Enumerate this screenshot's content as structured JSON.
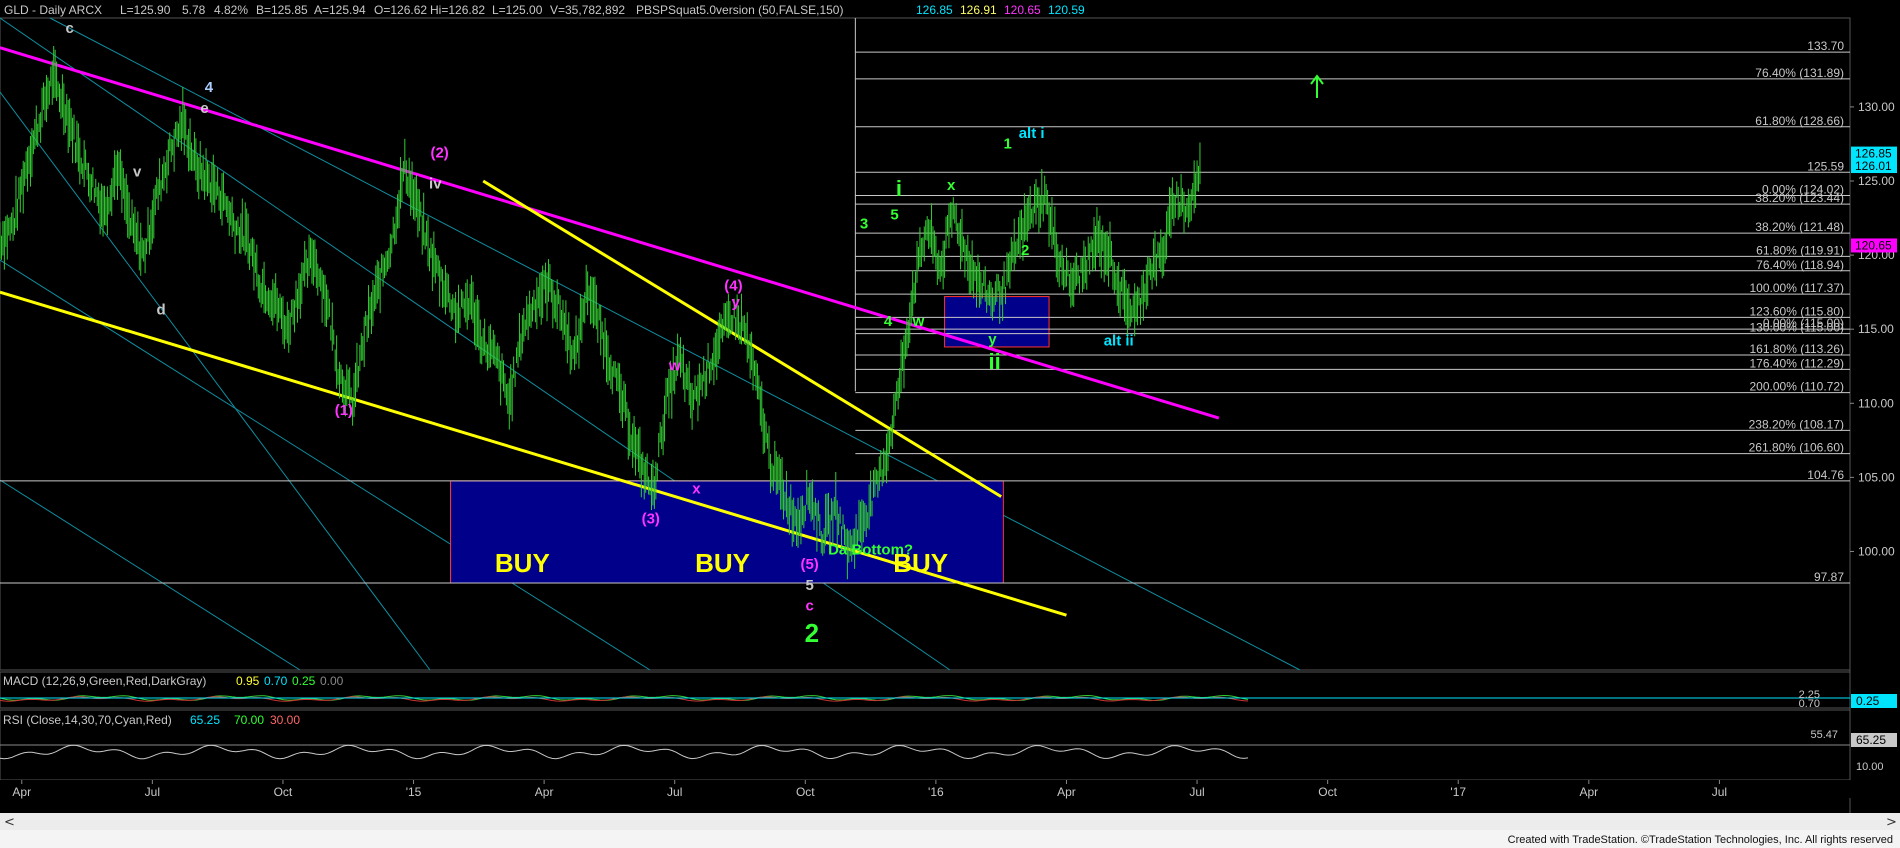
{
  "header": {
    "symbol": "GLD - Daily  ARCX",
    "last": "L=125.90",
    "change": "5.78",
    "pct": "4.82%",
    "bid": "B=125.85",
    "ask": "A=125.94",
    "open": "O=126.62",
    "high": "Hi=126.82",
    "low": "L=125.00",
    "volume": "V=35,782,892",
    "study": "PBSPSquat5.0version (50,FALSE,150)",
    "study_v1": "126.85",
    "study_v2": "126.91",
    "study_v3": "120.65",
    "study_v4": "120.59"
  },
  "colors": {
    "background": "#000000",
    "price_bars": "#33cc33",
    "fib_lines": "#c8c8c8",
    "support_line": "#ffff00",
    "resistance_line": "#ff00ff",
    "buy_box": "#00008b",
    "cyan": "#00e5ff",
    "green_label": "#33ff33",
    "magenta_label": "#ff33ff"
  },
  "chart_data": [
    {
      "type": "line",
      "title": "GLD - Daily ARCX",
      "ylim": [
        92,
        136
      ],
      "y_ticks": [
        "130.00",
        "125.00",
        "120.00",
        "115.00",
        "110.00",
        "105.00",
        "100.00"
      ],
      "x_ticks": [
        "Apr",
        "Jul",
        "Oct",
        "'15",
        "Apr",
        "Jul",
        "Oct",
        "'16",
        "Apr",
        "Jul",
        "Oct",
        "'17",
        "Apr",
        "Jul"
      ],
      "x_tick_pos": [
        0.5,
        3.5,
        6.5,
        9.5,
        12.5,
        15.5,
        18.5,
        21.5,
        24.5,
        27.5,
        30.5,
        33.5,
        36.5,
        39.5
      ],
      "x_range": [
        0,
        42.5
      ],
      "series": [
        {
          "name": "",
          "x": [
            0.0,
            0.3,
            0.6,
            0.9,
            1.2,
            1.5,
            1.8,
            2.1,
            2.4,
            2.7,
            3.0,
            3.3,
            3.6,
            3.9,
            4.2,
            4.5,
            4.8,
            5.1,
            5.4,
            5.7,
            6.0,
            6.3,
            6.6,
            6.9,
            7.2,
            7.5,
            7.8,
            8.1,
            8.4,
            8.7,
            9.0,
            9.3,
            9.6,
            9.9,
            10.2,
            10.5,
            10.8,
            11.1,
            11.4,
            11.7,
            12.0,
            12.3,
            12.6,
            12.9,
            13.2,
            13.5,
            13.8,
            14.1,
            14.4,
            14.7,
            15.0,
            15.3,
            15.6,
            15.9,
            16.2,
            16.5,
            16.8,
            17.1,
            17.4,
            17.7,
            18.0,
            18.3,
            18.6,
            18.9,
            19.2,
            19.5,
            19.8,
            20.1,
            20.4,
            20.7,
            21.0,
            21.3,
            21.6,
            21.9,
            22.2,
            22.5,
            22.8,
            23.1,
            23.4,
            23.7,
            24.0,
            24.3,
            24.6,
            24.9,
            25.2,
            25.5,
            25.8,
            26.1,
            26.4,
            26.7,
            27.0,
            27.3,
            27.6
          ],
          "y": [
            121,
            122,
            126,
            129,
            132,
            130,
            127,
            125,
            123,
            126,
            122,
            120,
            124,
            127,
            129,
            126,
            125,
            124,
            122,
            121,
            118,
            117,
            115,
            118,
            120,
            117,
            112,
            110,
            115,
            118,
            121,
            126,
            123,
            120,
            118,
            116,
            117,
            114,
            113,
            110,
            115,
            117,
            118,
            116,
            113,
            118,
            115,
            112,
            109,
            106,
            104,
            110,
            113,
            110,
            112,
            114,
            116,
            115,
            111,
            106,
            104,
            102,
            104,
            101,
            103,
            100,
            102,
            104,
            107,
            112,
            118,
            122,
            119,
            123,
            120,
            118,
            117,
            118,
            121,
            123,
            124,
            120,
            118,
            119,
            121,
            120,
            117,
            116,
            119,
            120,
            124,
            123,
            126
          ]
        }
      ],
      "h_levels": [
        {
          "label": "133.70",
          "y": 133.7
        },
        {
          "label": "76.40% (131.89)",
          "y": 131.89
        },
        {
          "label": "61.80% (128.66)",
          "y": 128.66
        },
        {
          "label": "125.59",
          "y": 125.59
        },
        {
          "label": "0.00% (124.02)",
          "y": 124.02
        },
        {
          "label": "38.20% (123.44)",
          "y": 123.44
        },
        {
          "label": "38.20% (121.48)",
          "y": 121.48
        },
        {
          "label": "61.80% (119.91)",
          "y": 119.91
        },
        {
          "label": "76.40% (118.94)",
          "y": 118.94
        },
        {
          "label": "100.00% (117.37)",
          "y": 117.37
        },
        {
          "label": "123.60% (115.80)",
          "y": 115.8
        },
        {
          "label": "0.00% (115.00)",
          "y": 115.0
        },
        {
          "label": "130.00% (115.00)",
          "y": 114.7
        },
        {
          "label": "161.80% (113.26)",
          "y": 113.26
        },
        {
          "label": "176.40% (112.29)",
          "y": 112.29
        },
        {
          "label": "200.00% (110.72)",
          "y": 110.72
        },
        {
          "label": "238.20% (108.17)",
          "y": 108.17
        },
        {
          "label": "261.80% (106.60)",
          "y": 106.6
        },
        {
          "label": "104.76",
          "y": 104.76
        },
        {
          "label": "97.87",
          "y": 97.87
        }
      ],
      "price_tags": [
        {
          "label": "126.85",
          "y": 126.85,
          "color": "#00e5ff"
        },
        {
          "label": "126.01",
          "y": 126.01,
          "color": "#00e5ff"
        },
        {
          "label": "120.65",
          "y": 120.65,
          "color": "#ff00ff"
        }
      ],
      "trendlines": [
        {
          "name": "magenta-resistance",
          "x": [
            0.0,
            28.0
          ],
          "y": [
            134.0,
            109.0
          ]
        },
        {
          "name": "yellow-upper",
          "x": [
            11.1,
            23.0
          ],
          "y": [
            125.0,
            103.7
          ]
        },
        {
          "name": "yellow-lower",
          "x": [
            0.0,
            24.5
          ],
          "y": [
            117.5,
            95.7
          ]
        }
      ],
      "annotations": [
        {
          "text": "c",
          "x": 1.6,
          "y": 135.0,
          "color": "#c8c8c8"
        },
        {
          "text": "4",
          "x": 4.8,
          "y": 131.0,
          "color": "#aaccff"
        },
        {
          "text": "e",
          "x": 4.7,
          "y": 129.6,
          "color": "#c8c8c8"
        },
        {
          "text": "v",
          "x": 3.15,
          "y": 125.3,
          "color": "#c8c8c8"
        },
        {
          "text": "d",
          "x": 3.7,
          "y": 116.0,
          "color": "#c8c8c8"
        },
        {
          "text": "(2)",
          "x": 10.1,
          "y": 126.6,
          "color": "#ff33ff"
        },
        {
          "text": "iv",
          "x": 10.0,
          "y": 124.5,
          "color": "#c8c8c8"
        },
        {
          "text": "(1)",
          "x": 7.9,
          "y": 109.2,
          "color": "#ff33ff"
        },
        {
          "text": "w",
          "x": 15.5,
          "y": 112.2,
          "color": "#ff33ff"
        },
        {
          "text": "(4)",
          "x": 16.85,
          "y": 117.6,
          "color": "#ff33ff"
        },
        {
          "text": "y",
          "x": 16.9,
          "y": 116.5,
          "color": "#ff33ff"
        },
        {
          "text": "x",
          "x": 16.0,
          "y": 103.9,
          "color": "#ff33ff"
        },
        {
          "text": "(3)",
          "x": 14.95,
          "y": 101.9,
          "color": "#ff33ff"
        },
        {
          "text": "(5)",
          "x": 18.6,
          "y": 98.8,
          "color": "#ff33ff"
        },
        {
          "text": "5",
          "x": 18.6,
          "y": 97.4,
          "color": "#c8c8c8"
        },
        {
          "text": "c",
          "x": 18.6,
          "y": 96.0,
          "color": "#ff33ff"
        },
        {
          "text": "2",
          "x": 18.65,
          "y": 93.9,
          "color": "#33ff33"
        },
        {
          "text": "Da Bottom?",
          "x": 20.0,
          "y": 99.8,
          "color": "#33ff33"
        },
        {
          "text": "i",
          "x": 20.65,
          "y": 124.0,
          "color": "#33ff33"
        },
        {
          "text": "3",
          "x": 19.85,
          "y": 121.8,
          "color": "#33ff33"
        },
        {
          "text": "5",
          "x": 20.55,
          "y": 122.4,
          "color": "#33ff33"
        },
        {
          "text": "4",
          "x": 20.4,
          "y": 115.2,
          "color": "#33ff33"
        },
        {
          "text": "w",
          "x": 21.1,
          "y": 115.2,
          "color": "#33ff33"
        },
        {
          "text": "x",
          "x": 21.85,
          "y": 124.4,
          "color": "#33ff33"
        },
        {
          "text": "1",
          "x": 23.15,
          "y": 127.2,
          "color": "#33ff33"
        },
        {
          "text": "alt i",
          "x": 23.7,
          "y": 127.9,
          "color": "#00e5ff"
        },
        {
          "text": "2",
          "x": 23.55,
          "y": 120.0,
          "color": "#33ff33"
        },
        {
          "text": "y",
          "x": 22.8,
          "y": 114.0,
          "color": "#33ff33"
        },
        {
          "text": "ii",
          "x": 22.85,
          "y": 112.3,
          "color": "#33ff33"
        },
        {
          "text": "alt ii",
          "x": 25.7,
          "y": 113.9,
          "color": "#00e5ff"
        },
        {
          "text": "BUY",
          "x": 12.0,
          "y": 98.6,
          "color": "#ffff00"
        },
        {
          "text": "BUY",
          "x": 16.6,
          "y": 98.6,
          "color": "#ffff00"
        },
        {
          "text": "BUY",
          "x": 21.15,
          "y": 98.6,
          "color": "#ffff00"
        }
      ],
      "buy_zones": [
        {
          "x": [
            10.35,
            23.05
          ],
          "y": [
            97.87,
            104.76
          ]
        },
        {
          "x": [
            21.7,
            24.1
          ],
          "y": [
            113.8,
            117.2
          ]
        }
      ]
    },
    {
      "type": "line",
      "title": "MACD (12,26,9,Green,Red,DarkGray)",
      "values_label": [
        "0.95",
        "0.70",
        "0.25",
        "0.00"
      ],
      "y_labels": [
        "2.25",
        "0.70",
        "0.25"
      ],
      "current": "0.25"
    },
    {
      "type": "line",
      "title": "RSI (Close,14,30,70,Cyan,Red)",
      "values_label": [
        "65.25",
        "70.00",
        "30.00"
      ],
      "y_labels": [
        "55.47",
        "65.25",
        "10.00"
      ],
      "current": "65.25"
    }
  ],
  "footer": {
    "credit": "Created with TradeStation. ©TradeStation Technologies, Inc. All rights reserved"
  }
}
